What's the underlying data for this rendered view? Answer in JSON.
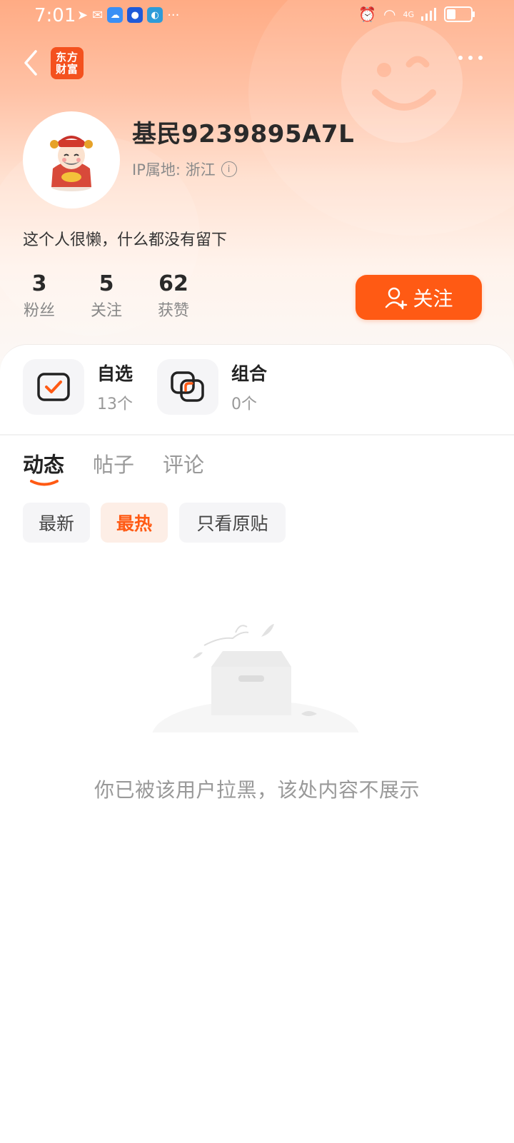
{
  "status_bar": {
    "time": "7:01",
    "more": "···",
    "signal_label": "4G"
  },
  "brand": {
    "logo_line1": "东方",
    "logo_line2": "财富",
    "accent_color": "#ff5a14"
  },
  "profile": {
    "username": "基民9239895A7L",
    "ip_label": "IP属地: 浙江",
    "bio": "这个人很懒，什么都没有留下"
  },
  "stats": [
    {
      "value": "3",
      "label": "粉丝"
    },
    {
      "value": "5",
      "label": "关注"
    },
    {
      "value": "62",
      "label": "获赞"
    }
  ],
  "follow_button": {
    "label": "关注"
  },
  "collections": [
    {
      "title": "自选",
      "count": "13个",
      "icon": "checkbox-icon"
    },
    {
      "title": "组合",
      "count": "0个",
      "icon": "portfolio-icon"
    }
  ],
  "tabs": [
    {
      "label": "动态",
      "active": true
    },
    {
      "label": "帖子",
      "active": false
    },
    {
      "label": "评论",
      "active": false
    }
  ],
  "filters": [
    {
      "label": "最新",
      "active": false
    },
    {
      "label": "最热",
      "active": true
    },
    {
      "label": "只看原贴",
      "active": false
    }
  ],
  "empty_state": {
    "message": "你已被该用户拉黑，该处内容不展示",
    "icon": "empty-box-icon"
  }
}
